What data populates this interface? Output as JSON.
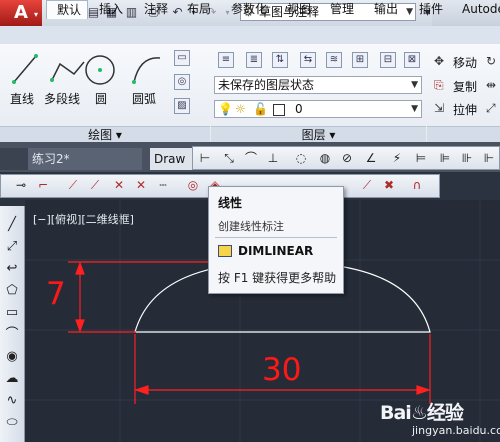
{
  "app": {
    "button_letter": "A",
    "workspace": "草图与注释",
    "colors": {
      "accent": "#c8231d",
      "dim_red": "#ff0000",
      "canvas_bg": "#252c38",
      "geometry": "#ffffff"
    }
  },
  "ribbon": {
    "tabs": [
      "默认",
      "插入",
      "注释",
      "布局",
      "参数化",
      "视图",
      "管理",
      "输出",
      "插件",
      "Autode"
    ],
    "draw_tools": [
      "直线",
      "多段线",
      "圆",
      "圆弧"
    ],
    "draw_panel_title": "绘图 ▾",
    "layer_state": "未保存的图层状态",
    "layer_value": "0",
    "layer_panel_title": "图层 ▾",
    "modify_tools": [
      "移动",
      "复制",
      "拉伸"
    ]
  },
  "file_tabs": [
    "练习2*",
    "Draw"
  ],
  "viewport_label": "[−][俯视][二维线框]",
  "tooltip": {
    "title": "线性",
    "description": "创建线性标注",
    "command": "DIMLINEAR",
    "help": "按 F1 键获得更多帮助"
  },
  "drawing": {
    "height_dim": "7",
    "width_dim": "30"
  },
  "watermark": {
    "brand": "Bai♨经验",
    "url": "jingyan.baidu.com"
  },
  "icons": [
    "new-icon",
    "open-icon",
    "save-icon",
    "saveas-icon",
    "plot-icon",
    "undo-icon",
    "redo-icon",
    "gear-icon",
    "line-icon",
    "polyline-icon",
    "circle-icon",
    "arc-icon",
    "bulb-icon",
    "sun-icon",
    "lock-icon",
    "move-icon",
    "copy-icon",
    "stretch-icon",
    "linear-dim-icon",
    "aligned-dim-icon"
  ]
}
